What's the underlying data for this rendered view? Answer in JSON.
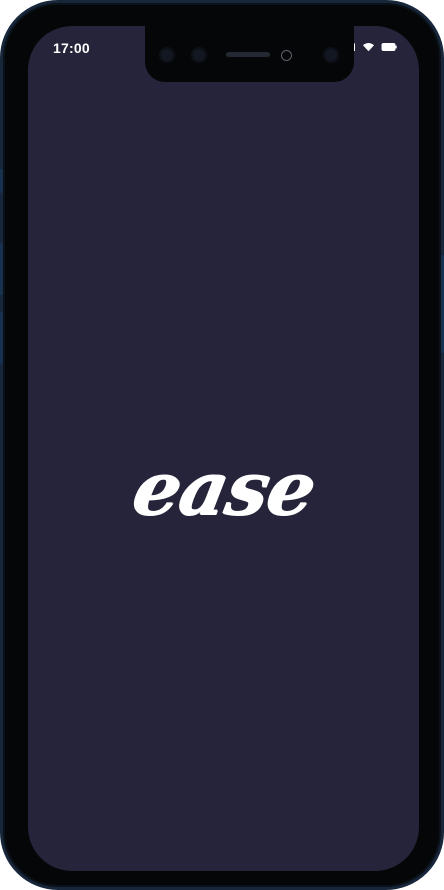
{
  "status_bar": {
    "time": "17:00",
    "icons": [
      "signal-icon",
      "wifi-icon",
      "battery-icon"
    ]
  },
  "app": {
    "logo_text": "ease"
  },
  "colors": {
    "screen_background": "#25243a",
    "device_frame": "#050607",
    "text": "#ffffff",
    "frame_accent": "#17263a"
  }
}
